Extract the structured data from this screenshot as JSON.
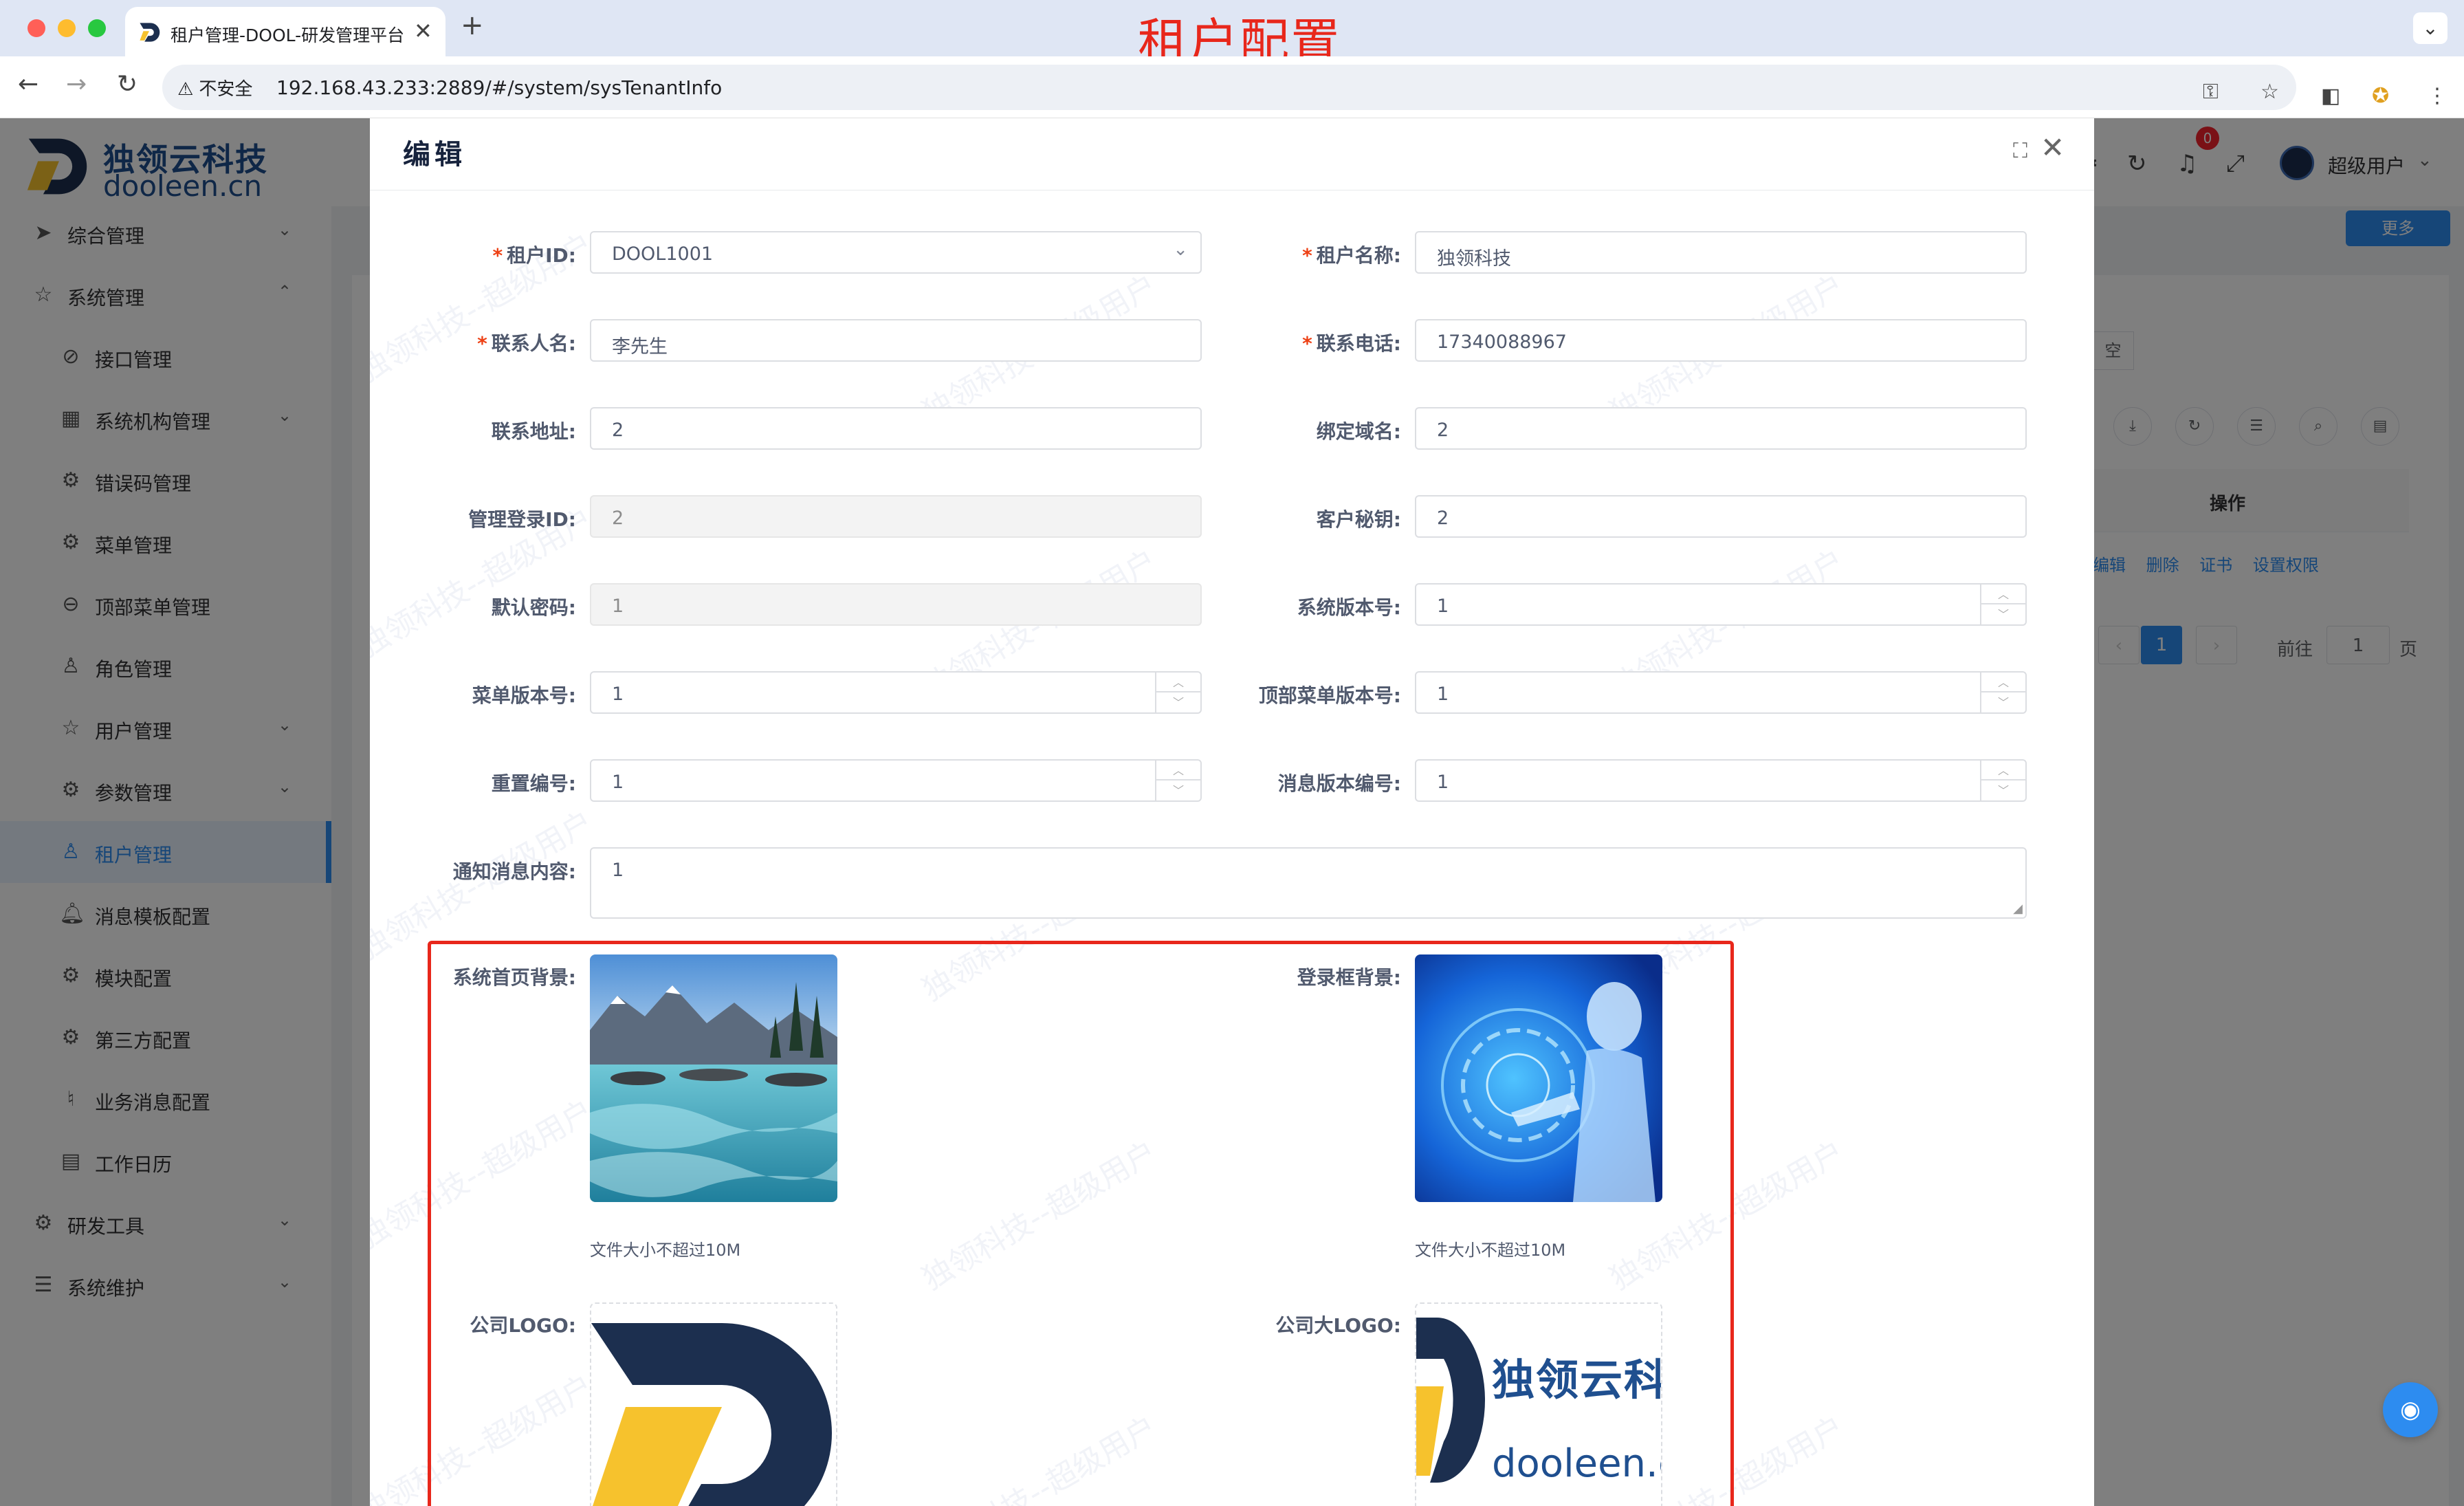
{
  "browser": {
    "tab_title": "租户管理-DOOL-研发管理平台",
    "new_tab": "+",
    "insecure_label": "不安全",
    "url": "192.168.43.233:2889/#/system/sysTenantInfo"
  },
  "banner": "租户配置",
  "sidebar": {
    "logo_cn": "独领云科技",
    "logo_en": "dooleen.cn",
    "items": [
      {
        "label": "综合管理",
        "icon": "send-icon"
      },
      {
        "label": "系统管理",
        "icon": "star-icon"
      },
      {
        "label": "接口管理",
        "icon": "api-icon"
      },
      {
        "label": "系统机构管理",
        "icon": "grid-icon"
      },
      {
        "label": "错误码管理",
        "icon": "gear-icon"
      },
      {
        "label": "菜单管理",
        "icon": "gear-icon"
      },
      {
        "label": "顶部菜单管理",
        "icon": "search-icon"
      },
      {
        "label": "角色管理",
        "icon": "user-icon"
      },
      {
        "label": "用户管理",
        "icon": "star-icon"
      },
      {
        "label": "参数管理",
        "icon": "gear-icon"
      },
      {
        "label": "租户管理",
        "icon": "user-icon"
      },
      {
        "label": "消息模板配置",
        "icon": "bell-icon"
      },
      {
        "label": "模块配置",
        "icon": "gear-icon"
      },
      {
        "label": "第三方配置",
        "icon": "gear-icon"
      },
      {
        "label": "业务消息配置",
        "icon": "bell-icon"
      },
      {
        "label": "工作日历",
        "icon": "calendar-icon"
      },
      {
        "label": "研发工具",
        "icon": "gear-icon"
      },
      {
        "label": "系统维护",
        "icon": "sliders-icon"
      }
    ]
  },
  "header": {
    "badge_count": "0",
    "username": "超级用户"
  },
  "background": {
    "more_button": "更多",
    "clear_button": "空",
    "table_header_action": "操作",
    "row_actions": [
      "编辑",
      "删除",
      "证书",
      "设置权限"
    ],
    "pager_current": "1",
    "pager_goto_prefix": "前往",
    "pager_goto_value": "1",
    "pager_goto_suffix": "页"
  },
  "modal": {
    "title": "编辑",
    "watermark": "独领科技--超级用户",
    "fields": {
      "tenant_id": {
        "label": "租户ID:",
        "value": "DOOL1001"
      },
      "tenant_name": {
        "label": "租户名称:",
        "value": "独领科技"
      },
      "contact_name": {
        "label": "联系人名:",
        "value": "李先生"
      },
      "contact_phone": {
        "label": "联系电话:",
        "value": "17340088967"
      },
      "contact_address": {
        "label": "联系地址:",
        "value": "2"
      },
      "bind_domain": {
        "label": "绑定域名:",
        "value": "2"
      },
      "admin_login_id": {
        "label": "管理登录ID:",
        "value": "2"
      },
      "client_secret": {
        "label": "客户秘钥:",
        "value": "2"
      },
      "default_password": {
        "label": "默认密码:",
        "value": "1"
      },
      "system_version": {
        "label": "系统版本号:",
        "value": "1"
      },
      "menu_version": {
        "label": "菜单版本号:",
        "value": "1"
      },
      "top_menu_version": {
        "label": "顶部菜单版本号:",
        "value": "1"
      },
      "reset_number": {
        "label": "重置编号:",
        "value": "1"
      },
      "message_version": {
        "label": "消息版本编号:",
        "value": "1"
      },
      "notice_content": {
        "label": "通知消息内容:",
        "value": "1"
      }
    },
    "images": {
      "home_bg_label": "系统首页背景:",
      "login_bg_label": "登录框背景:",
      "size_hint": "文件大小不超过10M",
      "logo_label": "公司LOGO:",
      "big_logo_label": "公司大LOGO:",
      "big_logo_text_cn": "独领云科技",
      "big_logo_text_en": "dooleen.cn"
    }
  }
}
